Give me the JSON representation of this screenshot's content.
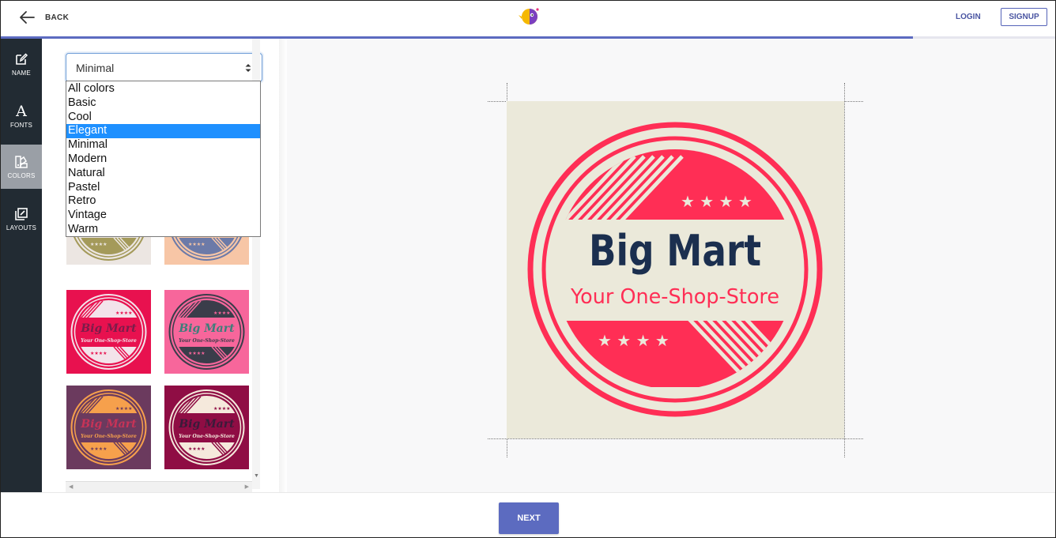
{
  "header": {
    "back_label": "BACK",
    "login_label": "LOGIN",
    "signup_label": "SIGNUP",
    "progress": 0.865,
    "accent_color": "#5c6bc0"
  },
  "sidebar": {
    "items": [
      {
        "label": "NAME",
        "icon": "edit-icon"
      },
      {
        "label": "FONTS",
        "icon": "fonts-icon"
      },
      {
        "label": "COLORS",
        "icon": "palette-icon",
        "active": true
      },
      {
        "label": "LAYOUTS",
        "icon": "layouts-icon"
      }
    ]
  },
  "filter": {
    "selected": "Minimal",
    "options": [
      "All colors",
      "Basic",
      "Cool",
      "Elegant",
      "Minimal",
      "Modern",
      "Natural",
      "Pastel",
      "Retro",
      "Vintage",
      "Warm"
    ],
    "highlighted": "Elegant"
  },
  "thumbnails": {
    "brand": "Big Mart",
    "tagline": "Your One-Shop-Store",
    "items": [
      {
        "bg": "#ece6e2",
        "ring": "#a49a5a",
        "band": "#a49a5a",
        "text": "#a49a5a"
      },
      {
        "bg": "#f7c6a6",
        "ring": "#6c7aa8",
        "band": "#6c7aa8",
        "text": "#6c7aa8"
      },
      {
        "bg": "#e8114f",
        "ring": "#f3e3ea",
        "band": "#f3e3ea",
        "text": "#7a1d4a"
      },
      {
        "bg": "#f7669b",
        "ring": "#3a3d4a",
        "band": "#3a3d4a",
        "text": "#3d7e7a"
      },
      {
        "bg": "#6b3a5e",
        "ring": "#f6a04c",
        "band": "#f6a04c",
        "text": "#c73357"
      },
      {
        "bg": "#8f0d44",
        "ring": "#f5e9dc",
        "band": "#f5e9dc",
        "text": "#3a1b3a"
      }
    ]
  },
  "preview": {
    "brand": "Big Mart",
    "tagline": "Your One-Shop-Store",
    "bg": "#ebe9da",
    "accent": "#ff2e55",
    "text_color": "#1b2f4f"
  },
  "footer": {
    "next_label": "NEXT"
  }
}
